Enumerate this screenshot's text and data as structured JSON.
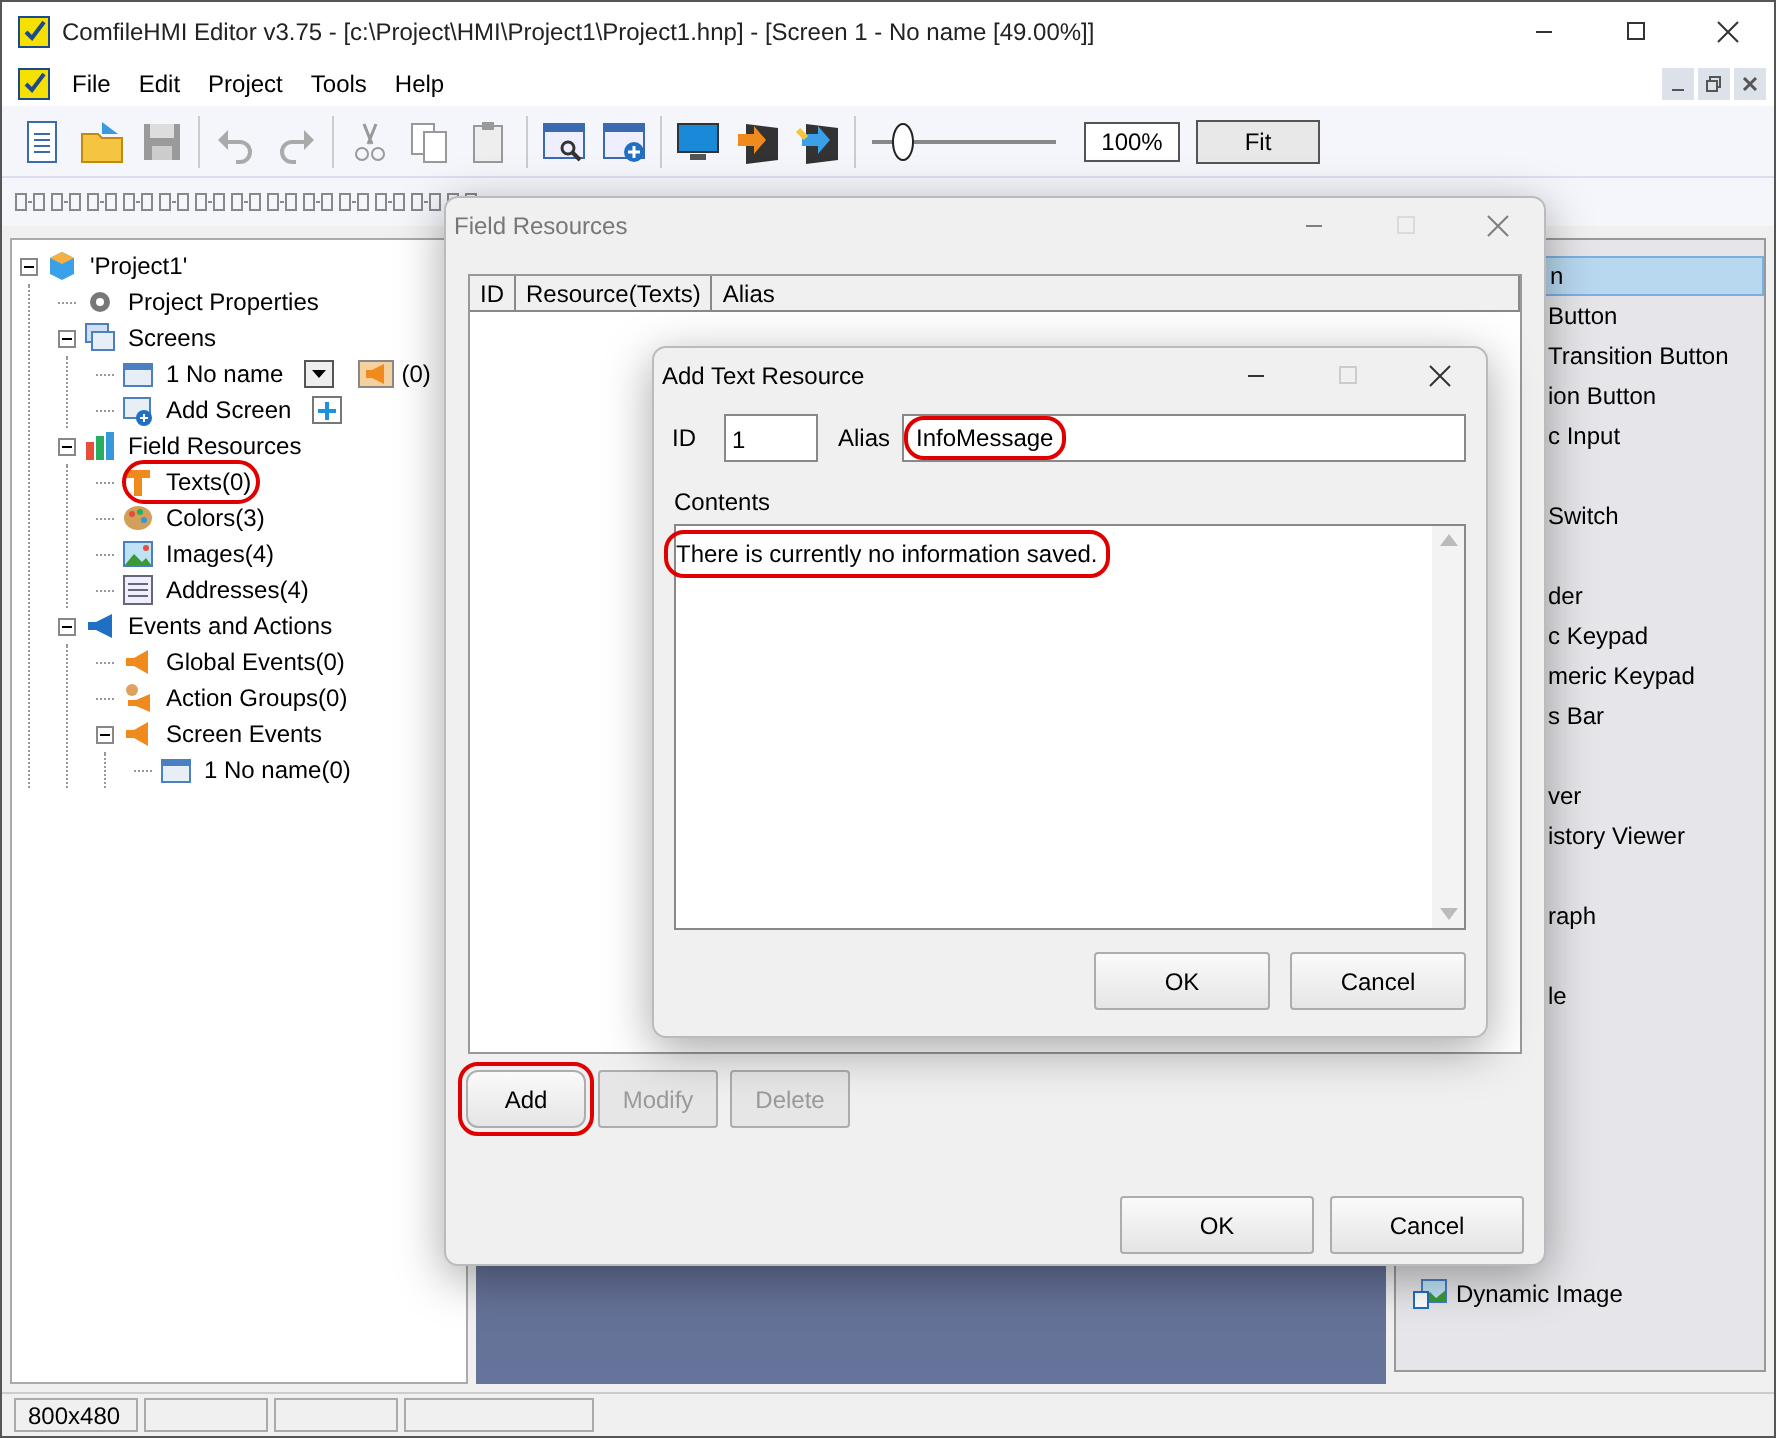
{
  "window": {
    "title": "ComfileHMI Editor v3.75 - [c:\\Project\\HMI\\Project1\\Project1.hnp] - [Screen 1 - No name [49.00%]]"
  },
  "menu": [
    "File",
    "Edit",
    "Project",
    "Tools",
    "Help"
  ],
  "toolbar": {
    "zoom": {
      "level": 0.17,
      "value": "100%"
    },
    "fit_button": "Fit"
  },
  "tree": [
    {
      "label": "'Project1'",
      "kind": "project",
      "expanded": true,
      "children": [
        {
          "label": "Project Properties",
          "kind": "properties"
        },
        {
          "label": "Screens",
          "kind": "screens",
          "expanded": true,
          "children": [
            {
              "label": "1 No name",
              "kind": "screen-item",
              "count": "(0)"
            },
            {
              "label": "Add Screen",
              "kind": "add-screen"
            }
          ]
        },
        {
          "label": "Field Resources",
          "kind": "resources",
          "expanded": true,
          "children": [
            {
              "label": "Texts(0)",
              "kind": "texts",
              "circled": true
            },
            {
              "label": "Colors(3)",
              "kind": "colors"
            },
            {
              "label": "Images(4)",
              "kind": "images"
            },
            {
              "label": "Addresses(4)",
              "kind": "addresses"
            }
          ]
        },
        {
          "label": "Events and Actions",
          "kind": "events",
          "expanded": true,
          "children": [
            {
              "label": "Global Events(0)",
              "kind": "event"
            },
            {
              "label": "Action Groups(0)",
              "kind": "action-groups"
            },
            {
              "label": "Screen Events",
              "kind": "event",
              "expanded": true,
              "children": [
                {
                  "label": "1 No name(0)",
                  "kind": "screen"
                }
              ]
            }
          ]
        }
      ]
    }
  ],
  "toolbox": {
    "groups": [
      {
        "items": [
          {
            "label": "n",
            "selected": true
          },
          {
            "label": "Button",
            "selected": false
          },
          {
            "label": "Transition Button",
            "selected": false
          },
          {
            "label": "ion Button",
            "selected": false
          },
          {
            "label": "c Input",
            "selected": false
          }
        ]
      },
      {
        "items": [
          {
            "label": "Switch",
            "selected": false
          }
        ]
      },
      {
        "items": [
          {
            "label": "der",
            "selected": false
          },
          {
            "label": "c Keypad",
            "selected": false
          },
          {
            "label": "meric Keypad",
            "selected": false
          },
          {
            "label": "s Bar",
            "selected": false
          }
        ]
      },
      {
        "items": [
          {
            "label": "ver",
            "selected": false
          },
          {
            "label": "istory Viewer",
            "selected": false
          }
        ]
      },
      {
        "items": [
          {
            "label": "raph",
            "selected": false
          }
        ]
      },
      {
        "items": [
          {
            "label": "le",
            "selected": false
          }
        ]
      }
    ],
    "visible_items": [
      {
        "label": "Dynamic Image"
      }
    ]
  },
  "field_resources": {
    "title": "Field Resources",
    "columns": [
      "ID",
      "Resource(Texts)",
      "Alias"
    ],
    "actions": [
      {
        "label": "Add",
        "disabled": false,
        "circled": true
      },
      {
        "label": "Modify",
        "disabled": true,
        "circled": false
      },
      {
        "label": "Delete",
        "disabled": true,
        "circled": false
      }
    ],
    "buttons": [
      "OK",
      "Cancel"
    ]
  },
  "add_text_resource": {
    "title": "Add Text Resource",
    "id_label": "ID",
    "id_value": "1",
    "alias_label": "Alias",
    "alias_value": "InfoMessage",
    "alias_circled": true,
    "contents_label": "Contents",
    "contents": "There is currently no information saved.",
    "contents_circled": true,
    "buttons": [
      "OK",
      "Cancel"
    ]
  },
  "status_bar": [
    "800x480"
  ]
}
